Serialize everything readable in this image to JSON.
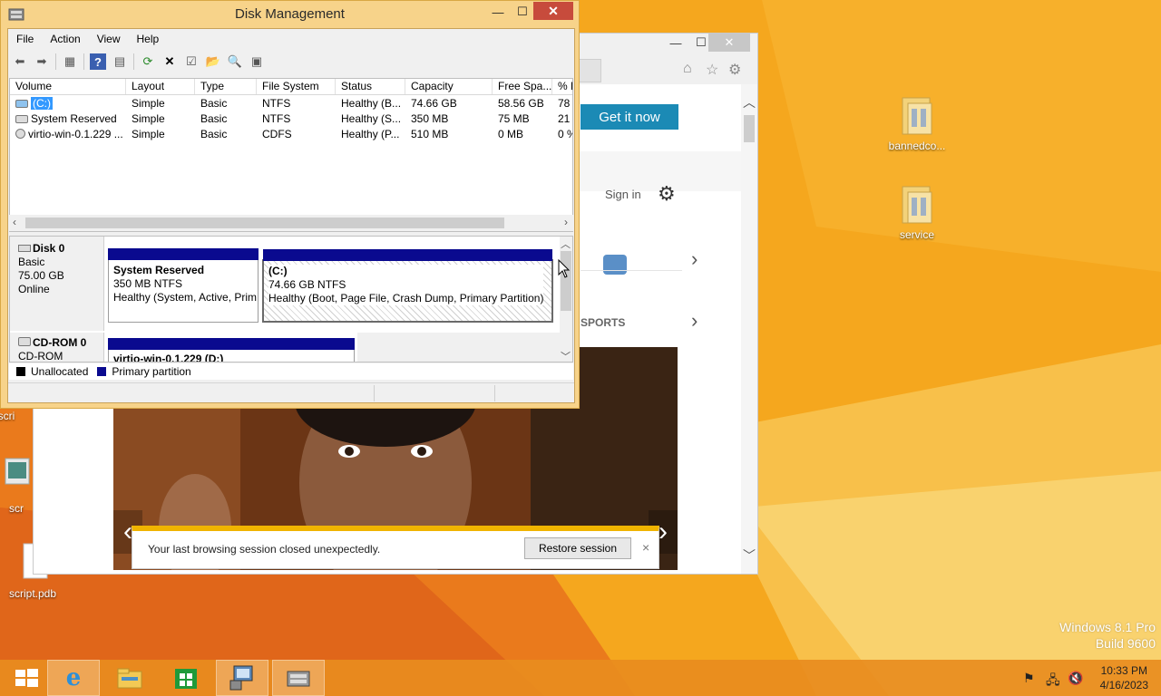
{
  "disk_management": {
    "title": "Disk Management",
    "menus": [
      "File",
      "Action",
      "View",
      "Help"
    ],
    "caption": {
      "minimize": "—",
      "maximize": "☐",
      "close": "✕"
    },
    "columns": [
      "Volume",
      "Layout",
      "Type",
      "File System",
      "Status",
      "Capacity",
      "Free Spa...",
      "% F"
    ],
    "volumes": [
      {
        "volume": "(C:)",
        "layout": "Simple",
        "type": "Basic",
        "fs": "NTFS",
        "status": "Healthy (B...",
        "capacity": "74.66 GB",
        "free": "58.56 GB",
        "pct": "78"
      },
      {
        "volume": "System Reserved",
        "layout": "Simple",
        "type": "Basic",
        "fs": "NTFS",
        "status": "Healthy (S...",
        "capacity": "350 MB",
        "free": "75 MB",
        "pct": "21"
      },
      {
        "volume": "virtio-win-0.1.229 ...",
        "layout": "Simple",
        "type": "Basic",
        "fs": "CDFS",
        "status": "Healthy (P...",
        "capacity": "510 MB",
        "free": "0 MB",
        "pct": "0 %"
      }
    ],
    "disk0": {
      "name": "Disk 0",
      "type": "Basic",
      "size": "75.00 GB",
      "state": "Online",
      "partitions": [
        {
          "name": "System Reserved",
          "size": "350 MB NTFS",
          "status": "Healthy (System, Active, Prim"
        },
        {
          "name": "(C:)",
          "size": "74.66 GB NTFS",
          "status": "Healthy (Boot, Page File, Crash Dump, Primary Partition)"
        }
      ]
    },
    "cdrom0": {
      "name": "CD-ROM 0",
      "type": "CD-ROM",
      "partition_name": "virtio-win-0.1.229  (D:)"
    },
    "legend": {
      "unallocated": "Unallocated",
      "primary": "Primary partition",
      "unallocated_color": "#000000",
      "primary_color": "#0a0a8f"
    }
  },
  "browser": {
    "get_it_now": "Get it now",
    "sign_in": "Sign in",
    "sports": "SPORTS",
    "notification": {
      "message": "Your last browsing session closed unexpectedly.",
      "restore": "Restore session",
      "close": "×"
    }
  },
  "desktop": {
    "icons": [
      "bannedco...",
      "service",
      "script.pdb",
      "scri",
      "scr"
    ],
    "watermark": {
      "line1": "Windows 8.1 Pro",
      "line2": "Build 9600"
    }
  },
  "taskbar": {
    "clock": {
      "time": "10:33 PM",
      "date": "4/16/2023"
    }
  }
}
